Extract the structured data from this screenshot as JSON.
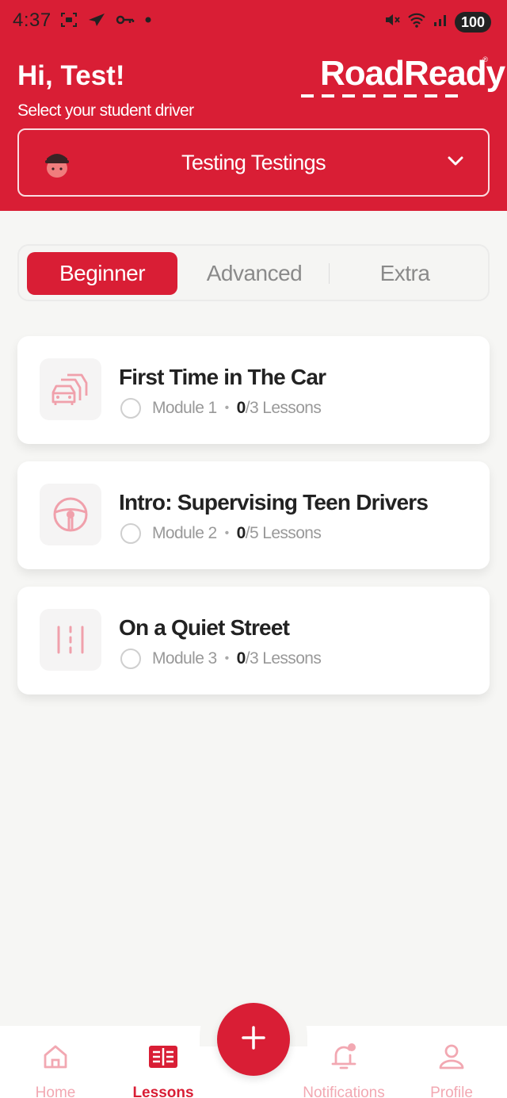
{
  "status_bar": {
    "time": "4:37",
    "battery": "100"
  },
  "header": {
    "greeting": "Hi, Test!",
    "subtitle": "Select your student driver",
    "logo_text": "RoadReady",
    "logo_mark": "®"
  },
  "driver_select": {
    "name": "Testing Testings",
    "avatar_icon": "student-avatar-icon"
  },
  "tabs": [
    {
      "label": "Beginner",
      "active": true
    },
    {
      "label": "Advanced",
      "active": false
    },
    {
      "label": "Extra",
      "active": false
    }
  ],
  "modules": [
    {
      "title": "First Time in The Car",
      "module": "Module 1",
      "completed": "0",
      "total": "/3 Lessons",
      "icon": "cars-icon"
    },
    {
      "title": "Intro: Supervising Teen Drivers",
      "module": "Module 2",
      "completed": "0",
      "total": "/5 Lessons",
      "icon": "steering-wheel-icon"
    },
    {
      "title": "On a Quiet Street",
      "module": "Module 3",
      "completed": "0",
      "total": "/3 Lessons",
      "icon": "road-lanes-icon"
    }
  ],
  "bottom_nav": {
    "items": [
      {
        "label": "Home",
        "icon": "home-icon",
        "active": false
      },
      {
        "label": "Lessons",
        "icon": "lessons-icon",
        "active": true
      },
      {
        "label": "Notifications",
        "icon": "bell-icon",
        "active": false
      },
      {
        "label": "Profile",
        "icon": "profile-icon",
        "active": false
      }
    ],
    "fab_icon": "plus-icon"
  },
  "colors": {
    "brand_red": "#d91e35",
    "icon_pink": "#f0a0ab",
    "background": "#f6f6f4"
  }
}
